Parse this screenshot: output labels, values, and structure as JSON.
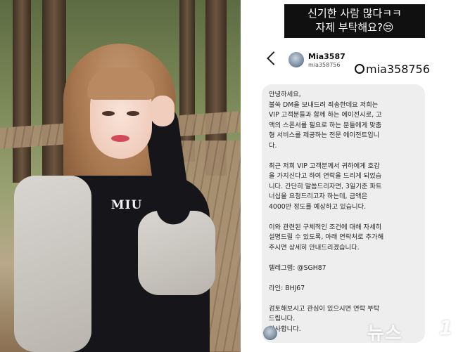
{
  "caption": {
    "line1": "신기한 사람 많다ㅋㅋ",
    "line2": "자제 부탁해요?😒"
  },
  "dm_header": {
    "name": "Mia3587",
    "handle": "mia358756"
  },
  "threads_tag": {
    "text": "mia358756",
    "icon": "threads-icon"
  },
  "message": {
    "lines": [
      "안녕하세요,",
      "불쑥 DM을 보내드려 죄송한데요 저희는",
      "VIP 고객분들과 함께 하는 에이전시로, 고",
      "액의 스폰서를 필요로 하는 분들에게 맞춤",
      "형 서비스를 제공하는 전문 에이전트입니",
      "다.",
      "",
      "최근 저희 VIP 고객분께서 귀하에게 호감",
      "을 가지신다고 하여 연락을 드리게 되었습",
      "니다. 간단히 말씀드리자면, 3일기준 파트",
      "너십을 요청드리고자 하는데, 금액은",
      "4000만  정도를 예상하고 있습니다.",
      "",
      "이와 관련된 구체적인 조건에 대해 자세히",
      "설명드릴 수 있도록, 아래 연락처로 추가해",
      "주시면 상세히 안내드리겠습니다.",
      "",
      "텔레그램:  @SGH87",
      "",
      "라인:  BHJ67",
      "",
      "검토해보시고 관심이 있으시면 연락 부탁",
      "드립니다.",
      "감사합니다."
    ]
  },
  "photo": {
    "shirt_logo": "MIU"
  },
  "watermark": {
    "text": "뉴스",
    "mark": "1"
  }
}
